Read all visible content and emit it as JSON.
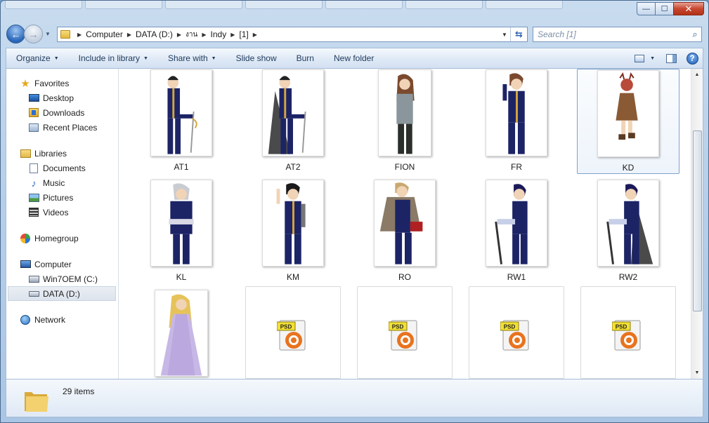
{
  "window": {
    "controls": {
      "minimize": "—",
      "maximize": "☐",
      "close": "✕"
    }
  },
  "address": {
    "segments": [
      "Computer",
      "DATA (D:)",
      "งาน",
      "Indy",
      "[1]"
    ]
  },
  "search": {
    "placeholder": "Search [1]"
  },
  "toolbar": {
    "organize": "Organize",
    "include": "Include in library",
    "share": "Share with",
    "slideshow": "Slide show",
    "burn": "Burn",
    "new_folder": "New folder"
  },
  "nav": {
    "favorites": "Favorites",
    "desktop": "Desktop",
    "downloads": "Downloads",
    "recent": "Recent Places",
    "libraries": "Libraries",
    "documents": "Documents",
    "music": "Music",
    "pictures": "Pictures",
    "videos": "Videos",
    "homegroup": "Homegroup",
    "computer": "Computer",
    "drive_c": "Win7OEM (C:)",
    "drive_d": "DATA (D:)",
    "network": "Network"
  },
  "files": {
    "at1": "AT1",
    "at2": "AT2",
    "fion": "FION",
    "fr": "FR",
    "kd": "KD",
    "kl": "KL",
    "km": "KM",
    "ro": "RO",
    "rw1": "RW1",
    "rw2": "RW2",
    "psd_badge": "PSD"
  },
  "status": {
    "count": "29 items"
  },
  "colors": {
    "selection": "#7da2ce",
    "toolbar_text": "#1e395b",
    "navy_costume": "#1c2466",
    "psd_orange": "#e8731f"
  }
}
